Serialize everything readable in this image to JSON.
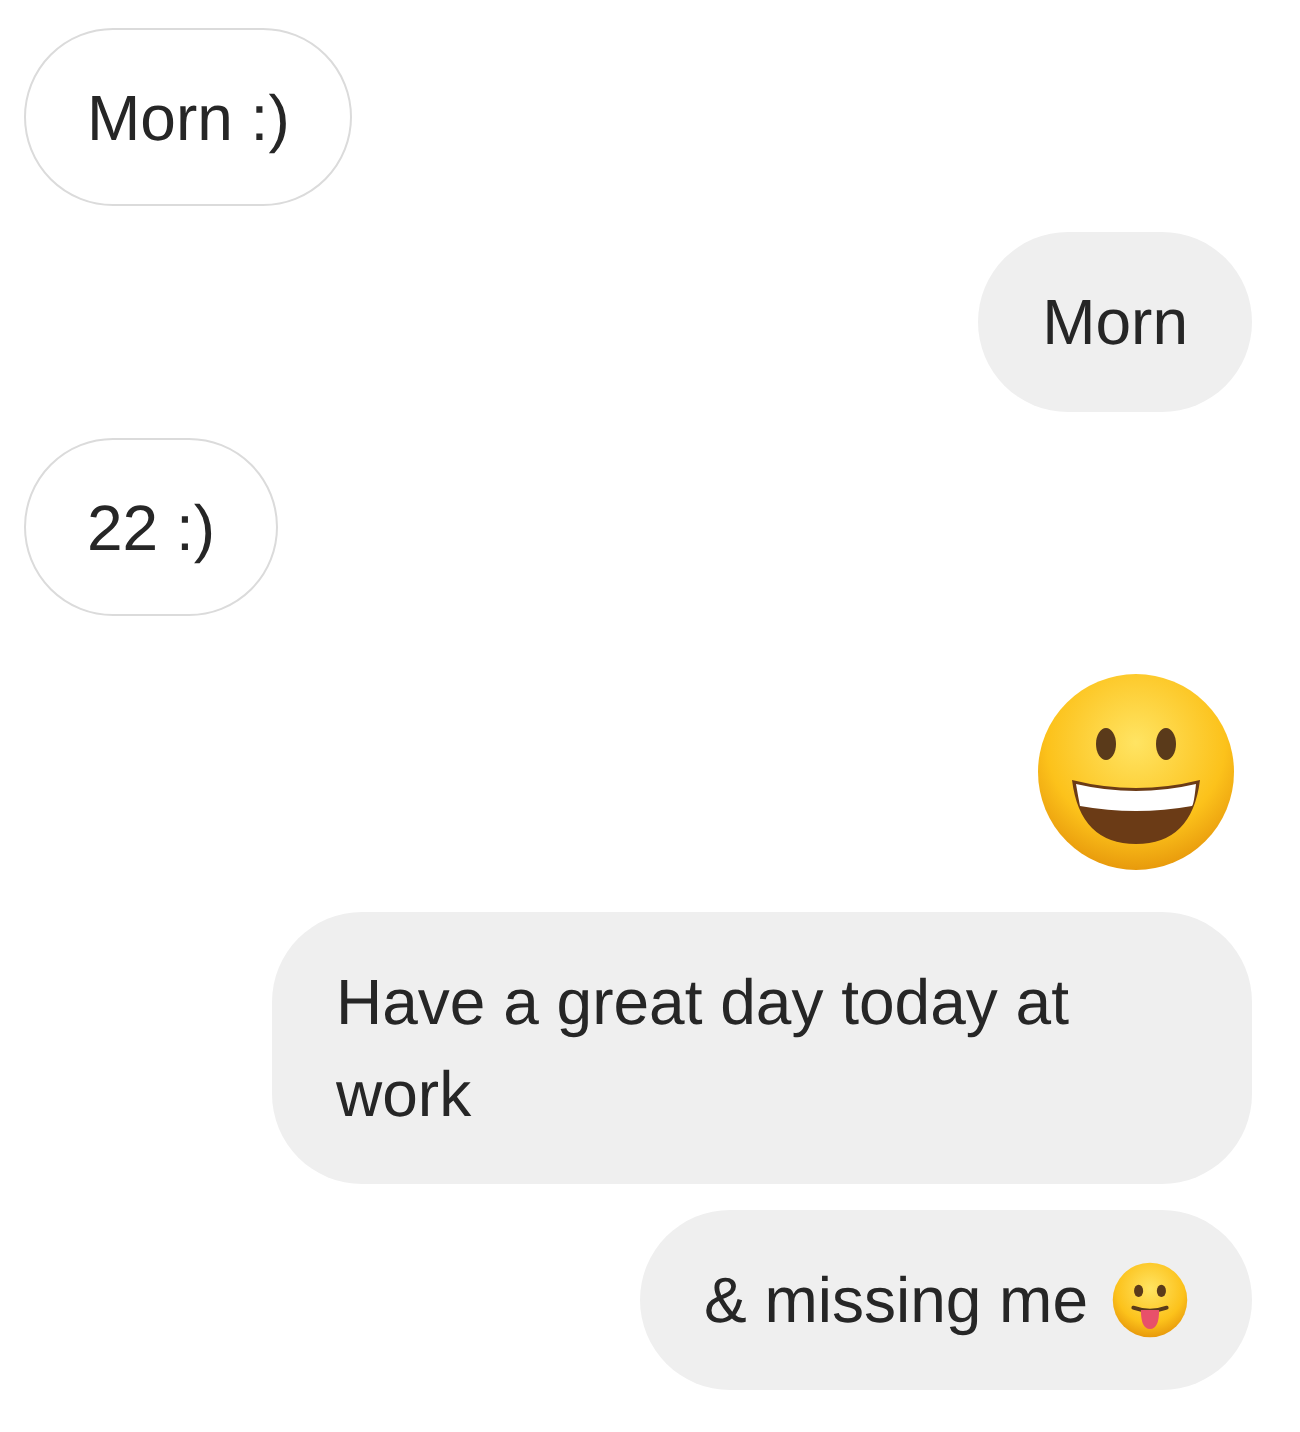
{
  "messages": [
    {
      "kind": "text",
      "outgoing": false,
      "text": "Morn :)"
    },
    {
      "kind": "text",
      "outgoing": true,
      "text": "Morn"
    },
    {
      "kind": "text",
      "outgoing": false,
      "text": "22 :)"
    },
    {
      "kind": "emoji",
      "outgoing": true
    },
    {
      "kind": "text",
      "outgoing": true,
      "text": "Have a great day today at work"
    },
    {
      "kind": "text",
      "outgoing": true,
      "text": "& missing me",
      "trailing_emoji": true
    }
  ]
}
